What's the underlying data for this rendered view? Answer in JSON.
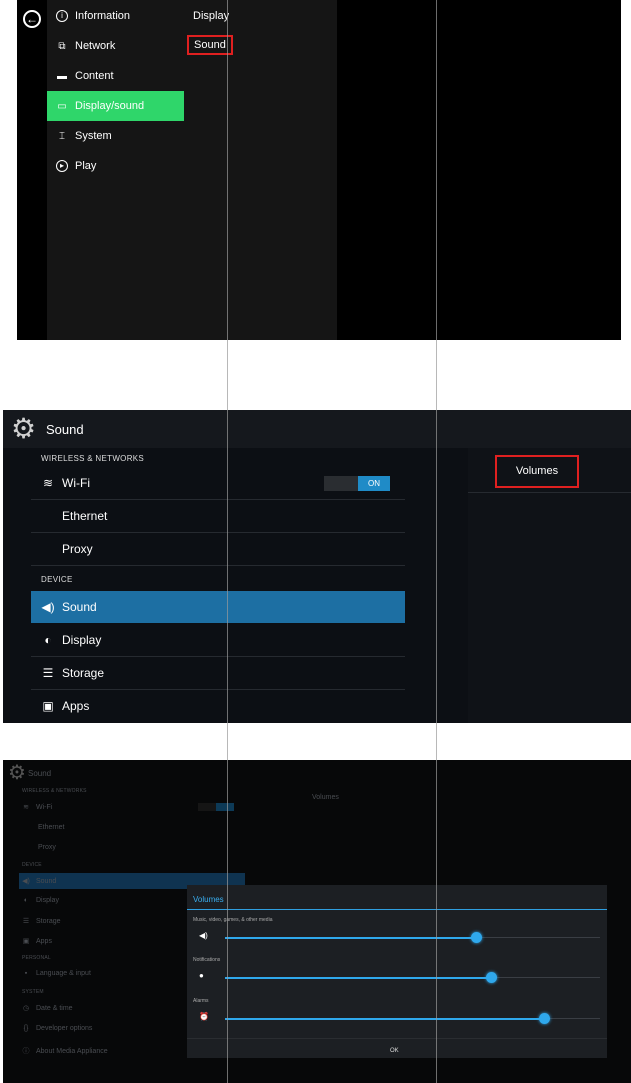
{
  "panel1": {
    "menu": [
      {
        "label": "Information",
        "icon": "info-icon",
        "active": false
      },
      {
        "label": "Network",
        "icon": "network-icon",
        "active": false
      },
      {
        "label": "Content",
        "icon": "folder-icon",
        "active": false
      },
      {
        "label": "Display/sound",
        "icon": "monitor-icon",
        "active": true
      },
      {
        "label": "System",
        "icon": "system-icon",
        "active": false
      },
      {
        "label": "Play",
        "icon": "play-icon",
        "active": false
      }
    ],
    "submenu": {
      "display": "Display",
      "sound": "Sound"
    },
    "accent": "#2fd66a",
    "highlight": "#e02020"
  },
  "panel2": {
    "title": "Sound",
    "categories": {
      "wireless": "WIRELESS & NETWORKS",
      "device": "DEVICE"
    },
    "items": [
      {
        "label": "Wi-Fi",
        "icon": "wifi-icon"
      },
      {
        "label": "Ethernet",
        "icon": ""
      },
      {
        "label": "Proxy",
        "icon": ""
      },
      {
        "label": "Sound",
        "icon": "speaker-icon",
        "active": true
      },
      {
        "label": "Display",
        "icon": "brightness-icon"
      },
      {
        "label": "Storage",
        "icon": "storage-icon"
      },
      {
        "label": "Apps",
        "icon": "apps-icon"
      }
    ],
    "wifi_toggle": "ON",
    "right_item": "Volumes",
    "accent": "#1d6fa3"
  },
  "panel3": {
    "title": "Sound",
    "categories": {
      "wireless": "WIRELESS & NETWORKS",
      "device": "DEVICE",
      "personal": "PERSONAL",
      "system": "SYSTEM"
    },
    "items": {
      "wifi": "Wi-Fi",
      "ethernet": "Ethernet",
      "proxy": "Proxy",
      "sound": "Sound",
      "display": "Display",
      "storage": "Storage",
      "apps": "Apps",
      "language": "Language & input",
      "datetime": "Date & time",
      "developer": "Developer options",
      "about": "About Media Appliance"
    },
    "right_item": "Volumes",
    "dialog": {
      "title": "Volumes",
      "sliders": [
        {
          "label": "Music, video, games, & other media",
          "icon": "speaker-icon",
          "value": 0.67
        },
        {
          "label": "Notifications",
          "icon": "notification-icon",
          "value": 0.71
        },
        {
          "label": "Alarms",
          "icon": "alarm-icon",
          "value": 0.85
        }
      ],
      "ok_label": "OK"
    },
    "accent": "#2fa8ec"
  }
}
